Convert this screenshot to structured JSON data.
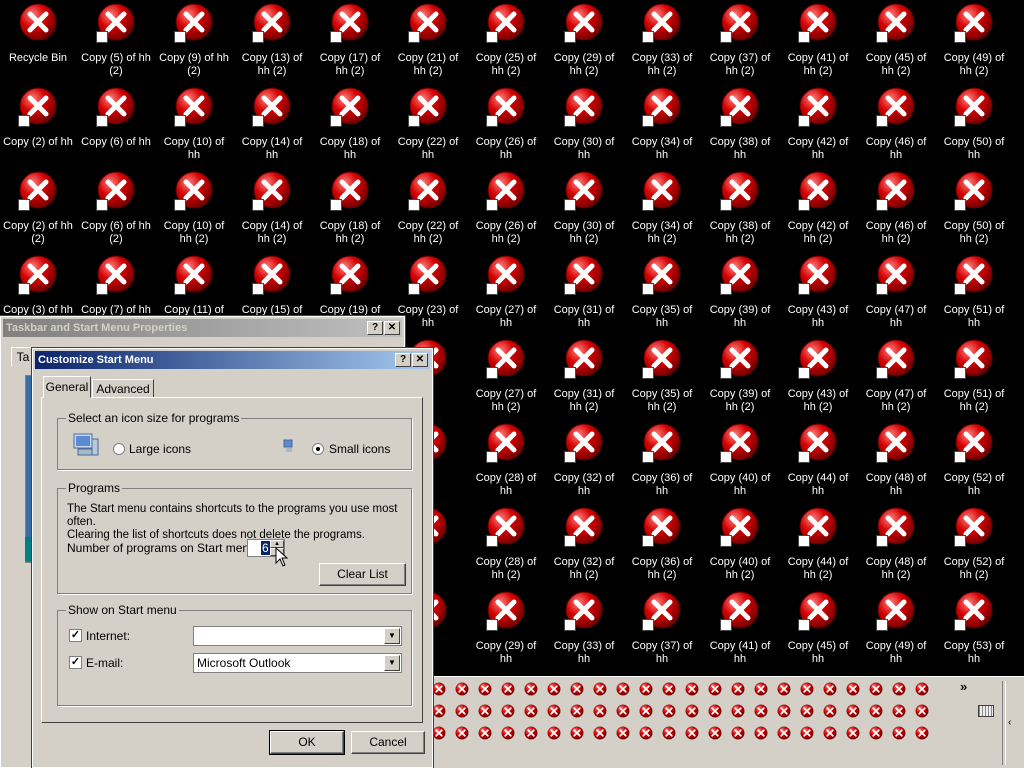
{
  "desktop": {
    "row_labels": [
      [
        "Recycle Bin",
        "Copy (5) of hh\n(2)",
        "Copy (9) of hh\n(2)",
        "Copy (13) of\nhh (2)",
        "Copy (17) of\nhh (2)",
        "Copy (21) of\nhh (2)",
        "Copy (25) of\nhh (2)",
        "Copy (29) of\nhh (2)",
        "Copy (33) of\nhh (2)",
        "Copy (37) of\nhh (2)",
        "Copy (41) of\nhh (2)",
        "Copy (45) of\nhh (2)",
        "Copy (49) of\nhh (2)"
      ],
      [
        "Copy (2) of hh",
        "Copy (6) of hh",
        "Copy (10) of\nhh",
        "Copy (14) of\nhh",
        "Copy (18) of\nhh",
        "Copy (22) of\nhh",
        "Copy (26) of\nhh",
        "Copy (30) of\nhh",
        "Copy (34) of\nhh",
        "Copy (38) of\nhh",
        "Copy (42) of\nhh",
        "Copy (46) of\nhh",
        "Copy (50) of\nhh"
      ],
      [
        "Copy (2) of hh\n(2)",
        "Copy (6) of hh\n(2)",
        "Copy (10) of\nhh (2)",
        "Copy (14) of\nhh (2)",
        "Copy (18) of\nhh (2)",
        "Copy (22) of\nhh (2)",
        "Copy (26) of\nhh (2)",
        "Copy (30) of\nhh (2)",
        "Copy (34) of\nhh (2)",
        "Copy (38) of\nhh (2)",
        "Copy (42) of\nhh (2)",
        "Copy (46) of\nhh (2)",
        "Copy (50) of\nhh (2)"
      ],
      [
        "Copy (3) of hh",
        "Copy (7) of hh",
        "Copy (11) of",
        "Copy (15) of",
        "Copy (19) of",
        "Copy (23) of\nhh",
        "Copy (27) of\nhh",
        "Copy (31) of\nhh",
        "Copy (35) of\nhh",
        "Copy (39) of\nhh",
        "Copy (43) of\nhh",
        "Copy (47) of\nhh",
        "Copy (51) of\nhh"
      ],
      [
        "",
        "",
        "",
        "",
        "",
        "(23) of\nhh (2)",
        "Copy (27) of\nhh (2)",
        "Copy (31) of\nhh (2)",
        "Copy (35) of\nhh (2)",
        "Copy (39) of\nhh (2)",
        "Copy (43) of\nhh (2)",
        "Copy (47) of\nhh (2)",
        "Copy (51) of\nhh (2)"
      ],
      [
        "",
        "",
        "",
        "",
        "",
        "(24) of",
        "Copy (28) of\nhh",
        "Copy (32) of\nhh",
        "Copy (36) of\nhh",
        "Copy (40) of\nhh",
        "Copy (44) of\nhh",
        "Copy (48) of\nhh",
        "Copy (52) of\nhh"
      ],
      [
        "",
        "",
        "",
        "",
        "",
        "(24) of",
        "Copy (28) of\nhh (2)",
        "Copy (32) of\nhh (2)",
        "Copy (36) of\nhh (2)",
        "Copy (40) of\nhh (2)",
        "Copy (44) of\nhh (2)",
        "Copy (48) of\nhh (2)",
        "Copy (52) of\nhh (2)"
      ],
      [
        "",
        "",
        "",
        "",
        "",
        "(25) of",
        "Copy (29) of\nhh",
        "Copy (33) of\nhh",
        "Copy (37) of\nhh",
        "Copy (41) of\nhh",
        "Copy (45) of\nhh",
        "Copy (49) of\nhh",
        "Copy (53) of\nhh"
      ]
    ],
    "icon_name": "error-x-icon",
    "icon_color": "#d40000"
  },
  "taskbar": {
    "chevron": "»",
    "tray_rows": 3,
    "tray_cols": 22
  },
  "back_window": {
    "title": "Taskbar and Start Menu Properties",
    "tab_fragment": "Ta",
    "help": "?",
    "close": "✕"
  },
  "dialog": {
    "title": "Customize Start Menu",
    "help": "?",
    "close": "✕",
    "tabs": [
      "General",
      "Advanced"
    ],
    "icon_size": {
      "legend": "Select an icon size for programs",
      "large_label": "Large icons",
      "small_label": "Small icons",
      "selected": "small"
    },
    "programs": {
      "legend": "Programs",
      "description": "The Start menu contains shortcuts to the programs you use most often.\nClearing the list of shortcuts does not delete the programs.",
      "count_label": "Number of programs on Start menu:",
      "count_value": "6",
      "clear_button": "Clear List"
    },
    "show_on_start": {
      "legend": "Show on Start menu",
      "internet_label": "Internet:",
      "internet_value": "",
      "email_label": "E-mail:",
      "email_value": "Microsoft Outlook"
    },
    "ok": "OK",
    "cancel": "Cancel"
  },
  "colors": {
    "title_active": "#0a246a",
    "face": "#d4d0c8",
    "desktop": "#000000"
  }
}
